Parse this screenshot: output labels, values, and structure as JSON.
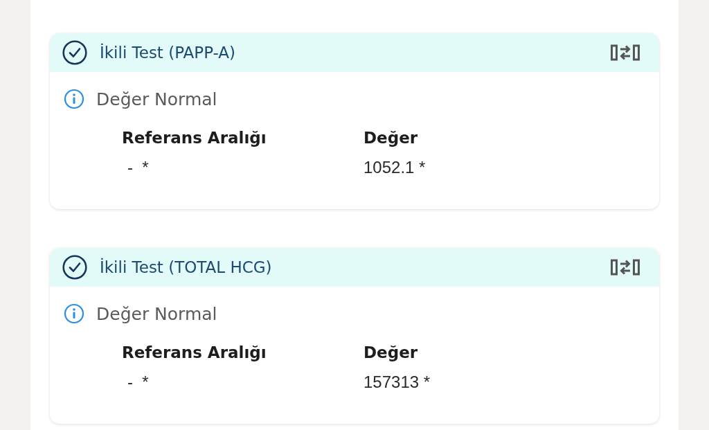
{
  "tests": [
    {
      "title": "İkili Test (PAPP-A)",
      "status": "Değer Normal",
      "columns": [
        "Referans Aralığı",
        "Değer"
      ],
      "values": [
        "-  *",
        "1052.1 *"
      ]
    },
    {
      "title": "İkili Test (TOTAL HCG)",
      "status": "Değer Normal",
      "columns": [
        "Referans Aralığı",
        "Değer"
      ],
      "values": [
        "-  *",
        "157313 *"
      ]
    }
  ]
}
